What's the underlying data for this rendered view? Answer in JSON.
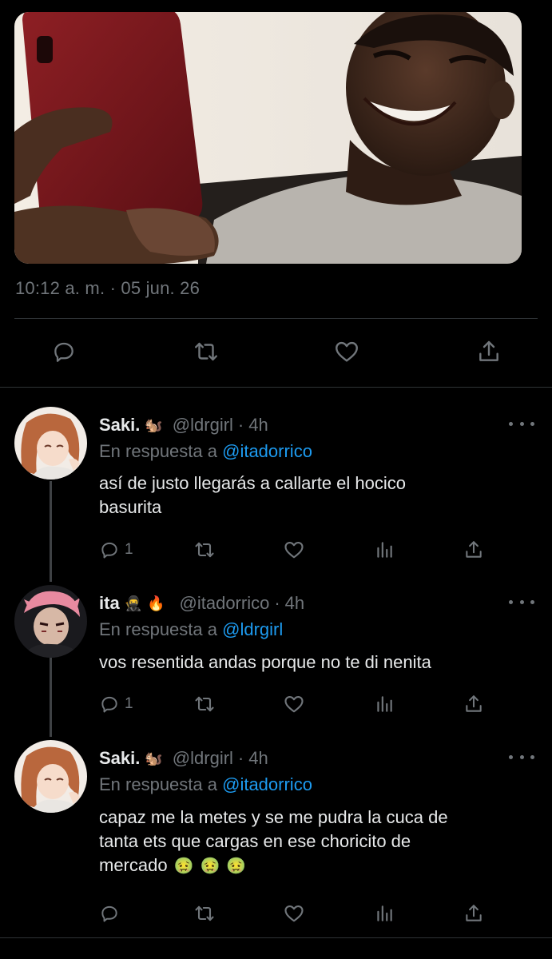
{
  "main_tweet": {
    "timestamp": "10:12 a. m. · 05 jun. 26",
    "actions": {
      "reply": "reply-icon",
      "retweet": "retweet-icon",
      "like": "heart-icon",
      "share": "share-icon"
    }
  },
  "replies": [
    {
      "name": "Saki.",
      "name_emoji": "🐿️",
      "handle": "@ldrgirl",
      "time": "4h",
      "reply_prefix": "En respuesta a",
      "reply_to": "@itadorrico",
      "text_lines": [
        "así de justo llegarás a callarte el hocico",
        "basurita"
      ],
      "reply_count": "1"
    },
    {
      "name": "ita",
      "name_emoji": "🥷🔥",
      "handle": "@itadorrico",
      "time": "4h",
      "reply_prefix": "En respuesta a",
      "reply_to": "@ldrgirl",
      "text_lines": [
        "vos resentida andas porque no te di nenita"
      ],
      "reply_count": "1"
    },
    {
      "name": "Saki.",
      "name_emoji": "🐿️",
      "handle": "@ldrgirl",
      "time": "4h",
      "reply_prefix": "En respuesta a",
      "reply_to": "@itadorrico",
      "text_lines": [
        "capaz me la metes y se me pudra la cuca de",
        "tanta ets que cargas en ese choricito de",
        "mercado"
      ],
      "trailing_emoji": "🤢🤢🤢",
      "reply_count": ""
    }
  ],
  "colors": {
    "background": "#000000",
    "text": "#e7e9ea",
    "muted": "#71767b",
    "link": "#1d9bf0",
    "divider": "#2f3336"
  }
}
